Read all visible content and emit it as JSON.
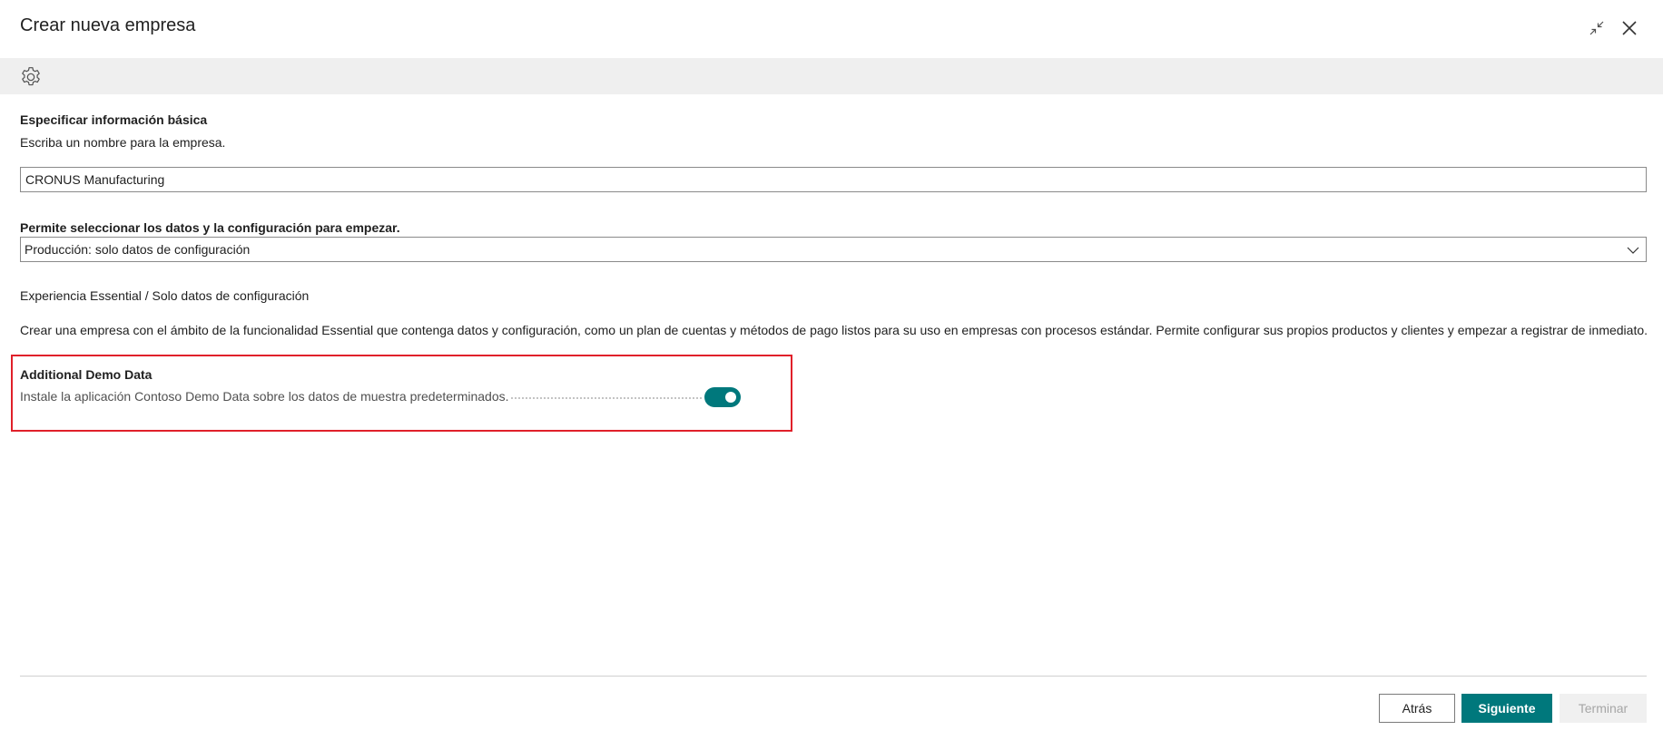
{
  "dialog": {
    "title": "Crear nueva empresa"
  },
  "window_controls": {
    "collapse_icon": "collapse-icon",
    "close_icon": "close-icon"
  },
  "actionbar": {
    "icon": "gear-icon"
  },
  "basic_info": {
    "heading": "Especificar información básica",
    "instruction": "Escriba un nombre para la empresa.",
    "company_name_value": "CRONUS Manufacturing"
  },
  "data_config": {
    "label": "Permite seleccionar los datos y la configuración para empezar.",
    "selected_option": "Producción: solo datos de configuración"
  },
  "experience": {
    "title": "Experiencia Essential / Solo datos de configuración",
    "description": "Crear una empresa con el ámbito de la funcionalidad Essential que contenga datos y configuración, como un plan de cuentas y métodos de pago listos para su uso en empresas con procesos estándar. Permite configurar sus propios productos y clientes y empezar a registrar de inmediato."
  },
  "demo_data": {
    "title": "Additional Demo Data",
    "description": "Instale la aplicación Contoso Demo Data sobre los datos de muestra predeterminados.",
    "enabled": true
  },
  "footer": {
    "back_label": "Atrás",
    "next_label": "Siguiente",
    "finish_label": "Terminar"
  },
  "colors": {
    "accent": "#00787c",
    "highlight_border": "#e0202a",
    "actionbar_bg": "#efefef"
  }
}
